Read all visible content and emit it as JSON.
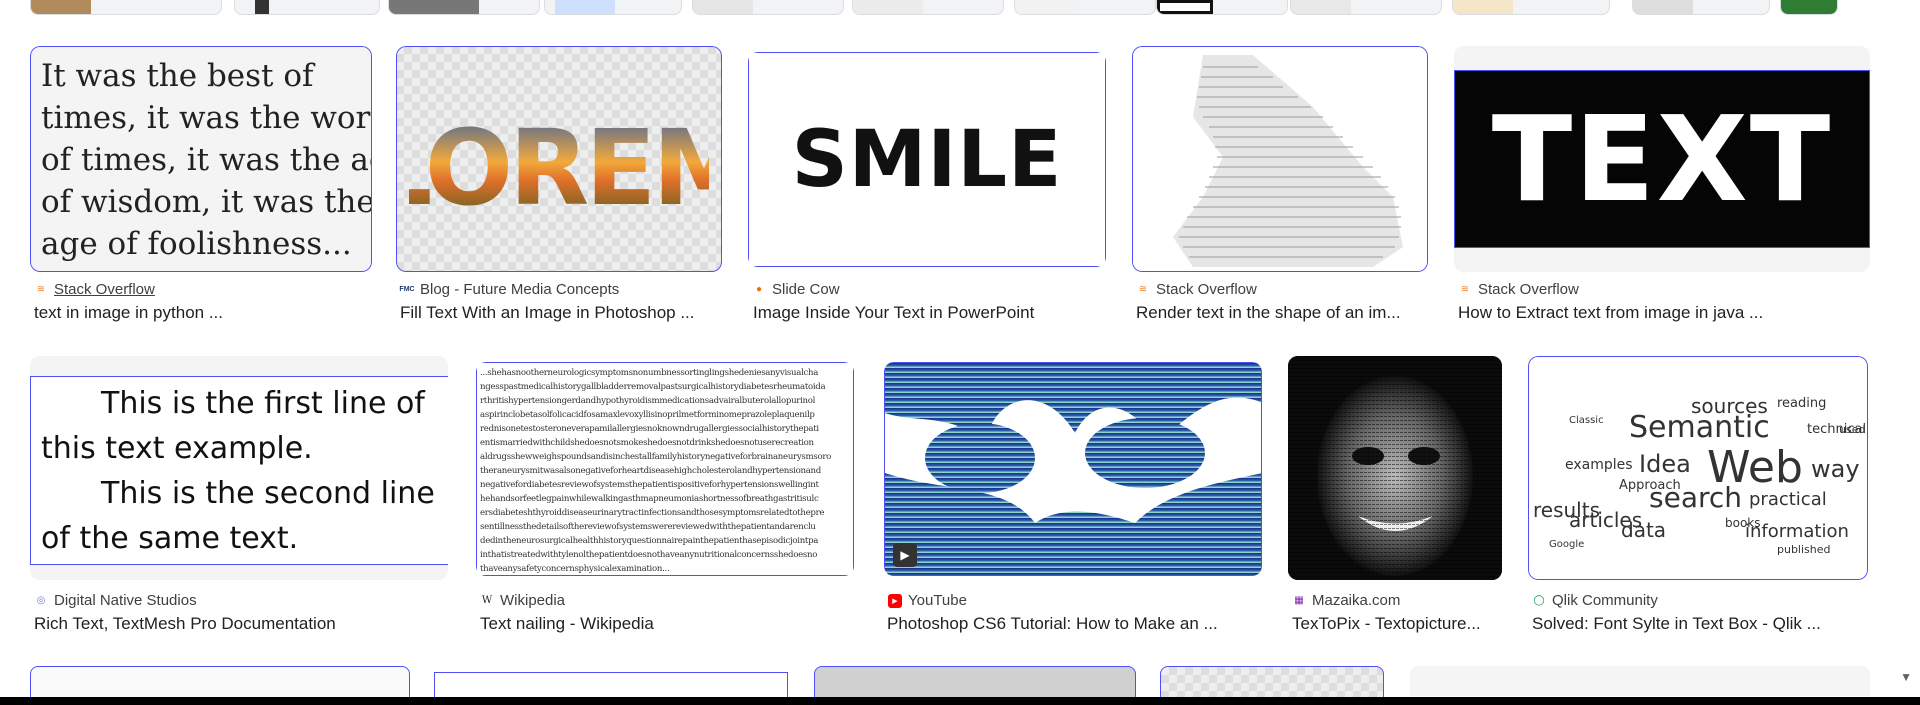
{
  "row1": [
    {
      "source": "Stack Overflow",
      "title": "text in image in python ...",
      "fav_color": "#f48024",
      "fav_glyph": "≋",
      "image_text": [
        "It was the best of",
        "times, it was the worst",
        "of times, it was the age",
        "of wisdom, it was the",
        "age of foolishness..."
      ]
    },
    {
      "source": "Blog - Future Media Concepts",
      "title": "Fill Text With an Image in Photoshop ...",
      "fav_color": "#1a3a6b",
      "fav_glyph": "FMC",
      "image_text": "LOREM"
    },
    {
      "source": "Slide Cow",
      "title": "Image Inside Your Text in PowerPoint",
      "fav_color": "#e8710a",
      "fav_glyph": "●",
      "image_text": "SMILE"
    },
    {
      "source": "Stack Overflow",
      "title": "Render text in the shape of an im...",
      "fav_color": "#f48024",
      "fav_glyph": "≋"
    },
    {
      "source": "Stack Overflow",
      "title": "How to Extract text from image in java ...",
      "fav_color": "#f48024",
      "fav_glyph": "≋",
      "image_text": "TEXT"
    }
  ],
  "row2": [
    {
      "source": "Digital Native Studios",
      "title": "Rich Text, TextMesh Pro Documentation",
      "fav_color": "#6b7fd7",
      "fav_glyph": "◎",
      "image_text": [
        "This is the first line of",
        "this text example.",
        "This is the second line",
        "of the same text."
      ]
    },
    {
      "source": "Wikipedia",
      "title": "Text nailing - Wikipedia",
      "fav_color": "#202124",
      "fav_glyph": "W",
      "image_text": [
        "...shehasnootherneurologicsymptomsnonumbnessortinglingshedeniesanyvisualcha",
        "ngesspastmedicalhistorygallbladderremovalpastsurgicalhistorydiabetesrheumatoida",
        "rthritishypertensiongerdandhypothyroidismmedicationsadvairalbuterolallopurinol",
        "aspirinclobetasolfolicacidfosamaxlevoxyllisinoprilmetforminomeprazoleplaquenilp",
        "rednisonetestosteroneverapamilallergiesnoknowndrugallergiessocialhistorythepati",
        "entismarriedwithchildshedoesnotsmokeshedoesnotdrinkshedoesnotuserecreation",
        "aldrugsshewweighspoundsandisinchestallfamilyhistorynegativeforbrainaneurysmsoro",
        "theraneurysmitwasalsonegativeforheartdiseasehighcholesterolandhypertensionand",
        "negativefordiabetesreviewofsystemsthepatientispositiveforhypertensionswellingint",
        "hehandsorfeetlegpainwhilewalkingasthmapneumoniashortnessofbreathgastritisulc",
        "ersdiabeteshthyroiddiseaseurinarytractinfectionsandthosesymptomsrelatedtothepre",
        "sentillnessthedetailsofthereviewofsystemswerereviewedwiththepatientandarenclu",
        "dedintheneurosurgicalhealthhistoryquestionnairepainthepatienthasepisodicjointpa",
        "inthatistreatedwithtylenolthepatientdoesnothaveanynutritionalconcernsshedoesno",
        "thaveanysafetyconcernsphysicalexamination..."
      ]
    },
    {
      "source": "YouTube",
      "title": "Photoshop CS6 Tutorial: How to Make an ...",
      "fav_color": "#ff0000",
      "fav_glyph": "▶"
    },
    {
      "source": "Mazaika.com",
      "title": "TexToPix - Textopicture...",
      "fav_color": "#7b1fa2",
      "fav_glyph": "▦"
    },
    {
      "source": "Qlik Community",
      "title": "Solved: Font Sylte in Text Box - Qlik ...",
      "fav_color": "#009845",
      "fav_glyph": "◯"
    }
  ],
  "wordcloud": [
    "Semantic",
    "Web",
    "search",
    "Idea",
    "sources",
    "data",
    "information",
    "articles",
    "results",
    "practical",
    "published",
    "examples",
    "Approach",
    "way",
    "reading",
    "technical",
    "used",
    "Classic",
    "Google",
    "books"
  ]
}
